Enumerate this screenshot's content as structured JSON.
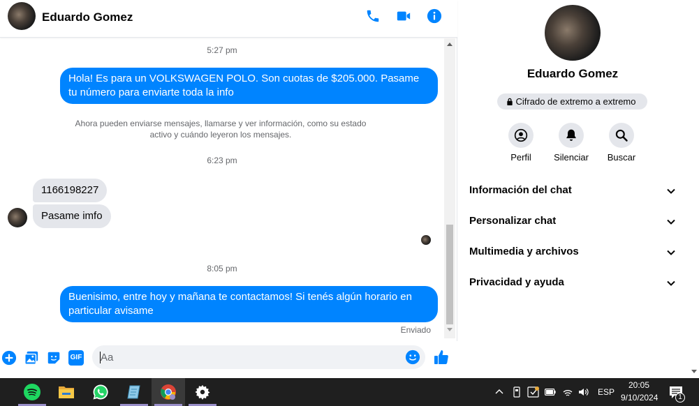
{
  "header": {
    "contact_name": "Eduardo Gomez",
    "icons": [
      "phone-icon",
      "video-icon",
      "info-icon"
    ]
  },
  "messages": {
    "time1": "5:27 pm",
    "out1": "Hola! Es para un VOLKSWAGEN POLO. Son cuotas de $205.000. Pasame tu número para enviarte toda la info",
    "system": "Ahora pueden enviarse mensajes, llamarse y ver información, como su estado activo y cuándo leyeron los mensajes.",
    "time2": "6:23 pm",
    "in1": "1166198227",
    "in2": "Pasame imfo",
    "time3": "8:05 pm",
    "out2": "Buenisimo, entre hoy y mañana te contactamos! Si tenés algún horario en particular avisame",
    "status": "Enviado"
  },
  "composer": {
    "placeholder": "Aa",
    "gif_label": "GIF",
    "icons": [
      "plus-icon",
      "image-icon",
      "sticker-icon",
      "gif-icon",
      "emoji-icon",
      "like-icon"
    ]
  },
  "sidebar": {
    "name": "Eduardo Gomez",
    "e2e": "Cifrado de extremo a extremo",
    "actions": [
      {
        "label": "Perfil",
        "icon": "profile-icon"
      },
      {
        "label": "Silenciar",
        "icon": "bell-icon"
      },
      {
        "label": "Buscar",
        "icon": "search-icon"
      }
    ],
    "sections": [
      {
        "label": "Información del chat"
      },
      {
        "label": "Personalizar chat"
      },
      {
        "label": "Multimedia y archivos"
      },
      {
        "label": "Privacidad y ayuda"
      }
    ]
  },
  "taskbar": {
    "apps": [
      "spotify-icon",
      "file-explorer-icon",
      "whatsapp-icon",
      "notepad-icon",
      "chrome-icon",
      "settings-icon"
    ],
    "language": "ESP",
    "time": "20:05",
    "date": "9/10/2024",
    "notification_count": "1"
  },
  "colors": {
    "accent": "#0084ff",
    "bubble_in": "#e4e6eb",
    "taskbar": "#1f1f1f"
  }
}
